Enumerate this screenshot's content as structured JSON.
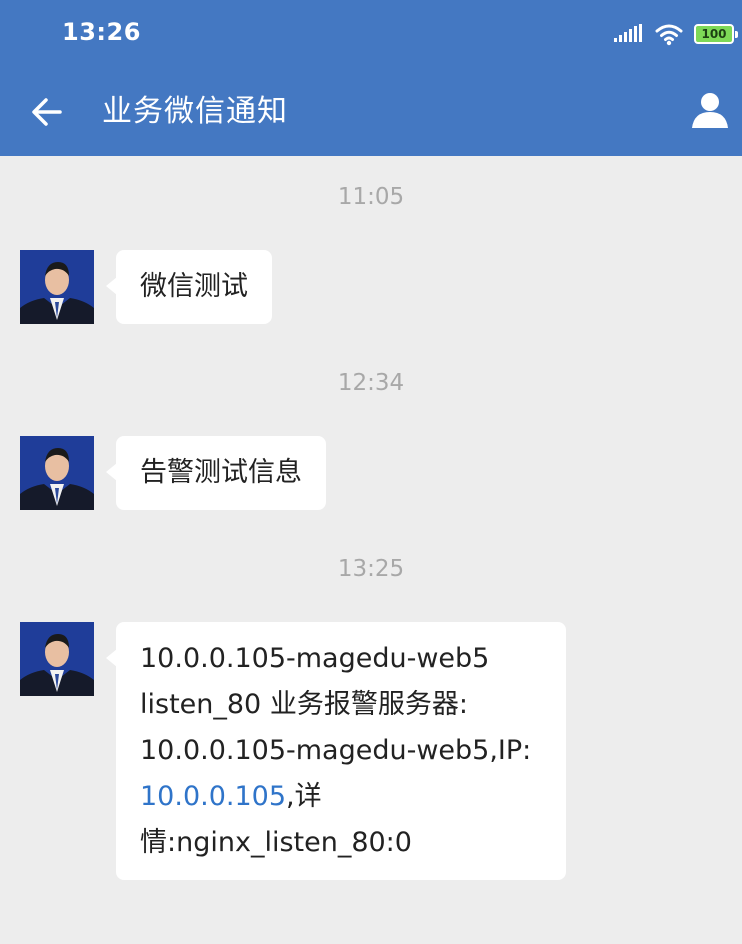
{
  "status_bar": {
    "time": "13:26",
    "battery": "100",
    "icons": [
      "signal-icon",
      "wifi-icon",
      "battery-icon"
    ]
  },
  "app_bar": {
    "title": "业务微信通知",
    "back_icon": "arrow-left-icon",
    "profile_icon": "person-icon"
  },
  "messages": [
    {
      "time": "11:05",
      "text": "微信测试"
    },
    {
      "time": "12:34",
      "text": "告警测试信息"
    },
    {
      "time": "13:25",
      "lines": {
        "l1": "10.0.0.105-magedu-web5",
        "l2": "listen_80 业务报警服务器:",
        "l3": "10.0.0.105-magedu-web5,IP:",
        "l4_link": "10.0.0.105",
        "l4_rest": ",详",
        "l5": "情:nginx_listen_80:0"
      }
    }
  ],
  "colors": {
    "header": "#4478c2",
    "background": "#ededed",
    "bubble": "#ffffff",
    "link": "#2f74c9",
    "timestamp": "#a8a8a8",
    "battery_fill": "#7ed957"
  }
}
